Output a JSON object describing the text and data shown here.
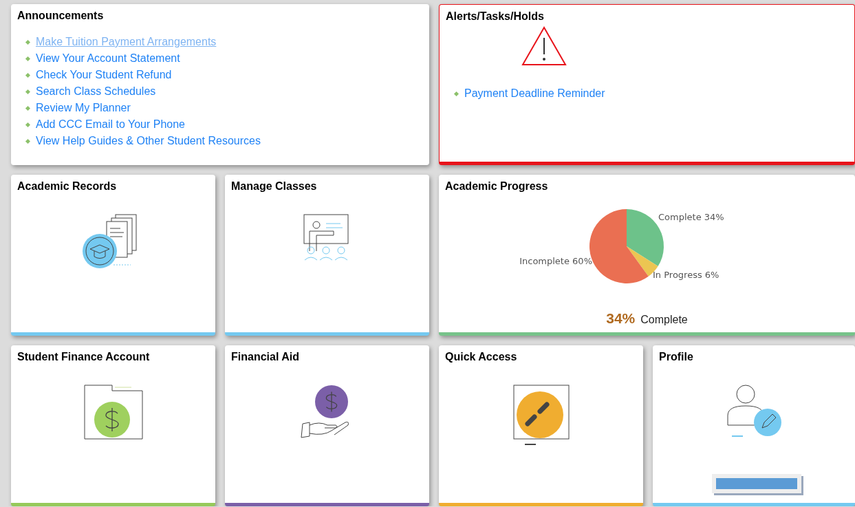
{
  "announcements": {
    "title": "Announcements",
    "links": [
      {
        "label": "Make Tuition Payment Arrangements",
        "highlighted": true
      },
      {
        "label": "View Your Account Statement",
        "highlighted": false
      },
      {
        "label": "Check Your Student Refund",
        "highlighted": false
      },
      {
        "label": "Search Class Schedules",
        "highlighted": false
      },
      {
        "label": "Review My Planner",
        "highlighted": false
      },
      {
        "label": "Add CCC Email to Your Phone",
        "highlighted": false
      },
      {
        "label": "View Help Guides & Other Student Resources",
        "highlighted": false
      }
    ]
  },
  "alerts": {
    "title": "Alerts/Tasks/Holds",
    "links": [
      "Payment Deadline Reminder"
    ],
    "color": "#e8141b"
  },
  "tiles": [
    {
      "kind": "records",
      "title": "Academic Records",
      "color": "#74c9f0"
    },
    {
      "kind": "classes",
      "title": "Manage Classes",
      "color": "#74c9f0"
    },
    {
      "kind": "progress",
      "title": "Academic Progress",
      "color": "#77c38a",
      "summary_value": "34%",
      "summary_label": "Complete",
      "chart_data": {
        "type": "pie",
        "series": [
          {
            "values": [
              34,
              6,
              60
            ]
          }
        ],
        "colors": [
          "#6dc28a",
          "#ecc552",
          "#ea6f52"
        ],
        "value_labels": [
          "Complete 34%",
          "In Progress 6%",
          "Incomplete 60%"
        ]
      }
    },
    {
      "kind": "finance",
      "title": "Student Finance Account",
      "color": "#96c95a"
    },
    {
      "kind": "aid",
      "title": "Financial Aid",
      "color": "#7b5fa8"
    },
    {
      "kind": "quick",
      "title": "Quick Access",
      "color": "#f0ad30"
    },
    {
      "kind": "profile",
      "title": "Profile",
      "color": "#74c9f0",
      "overlay_bar": true
    }
  ]
}
